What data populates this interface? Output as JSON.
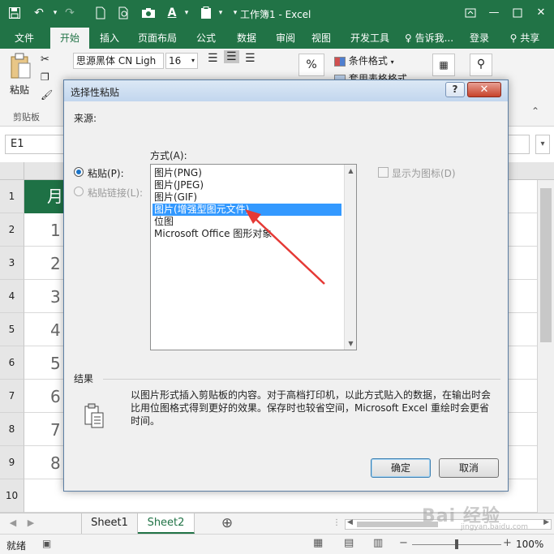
{
  "window": {
    "title": "工作簿1 - Excel"
  },
  "ribbon": {
    "tabs": [
      "文件",
      "开始",
      "插入",
      "页面布局",
      "公式",
      "数据",
      "审阅",
      "视图",
      "开发工具"
    ],
    "active_tab": "开始",
    "tell_me": "告诉我...",
    "login": "登录",
    "share": "共享",
    "font_name": "思源黑体 CN Ligh",
    "font_size": "16",
    "paste_label": "粘贴",
    "clipboard_group": "剪贴板",
    "percent": "%",
    "conditional_format": "条件格式",
    "table_format": "套用表格格式"
  },
  "formula_bar": {
    "name_box": "E1"
  },
  "grid": {
    "row_numbers": [
      "1",
      "2",
      "3",
      "4",
      "5",
      "6",
      "7",
      "8",
      "9",
      "10"
    ],
    "a1_text": "月",
    "cell_digits": [
      "1",
      "2",
      "3",
      "4",
      "5",
      "6",
      "7",
      "8"
    ]
  },
  "sheets": {
    "tabs": [
      "Sheet1",
      "Sheet2"
    ],
    "active": "Sheet2",
    "add_symbol": "⊕"
  },
  "status": {
    "ready": "就绪",
    "zoom": "100%",
    "minus": "−",
    "plus": "+"
  },
  "dialog": {
    "title": "选择性粘贴",
    "source_label": "来源:",
    "format_label": "方式(A):",
    "paste_option": "粘贴(P):",
    "paste_link_option": "粘贴链接(L):",
    "list_items": [
      "图片(PNG)",
      "图片(JPEG)",
      "图片(GIF)",
      "图片(增强型图元文件)",
      "位图",
      "Microsoft Office 图形对象"
    ],
    "selected_item": "图片(增强型图元文件)",
    "display_as_icon": "显示为图标(D)",
    "result_label": "结果",
    "result_text": "以图片形式插入剪贴板的内容。对于高档打印机，以此方式贴入的数据，在输出时会比用位图格式得到更好的效果。保存时也较省空间，Microsoft Excel 重绘时会更省时间。",
    "ok": "确定",
    "cancel": "取消",
    "help": "?",
    "close": "✕"
  },
  "colors": {
    "excel_green": "#217346",
    "selection_blue": "#3399ff",
    "arrow_red": "#e53935"
  }
}
